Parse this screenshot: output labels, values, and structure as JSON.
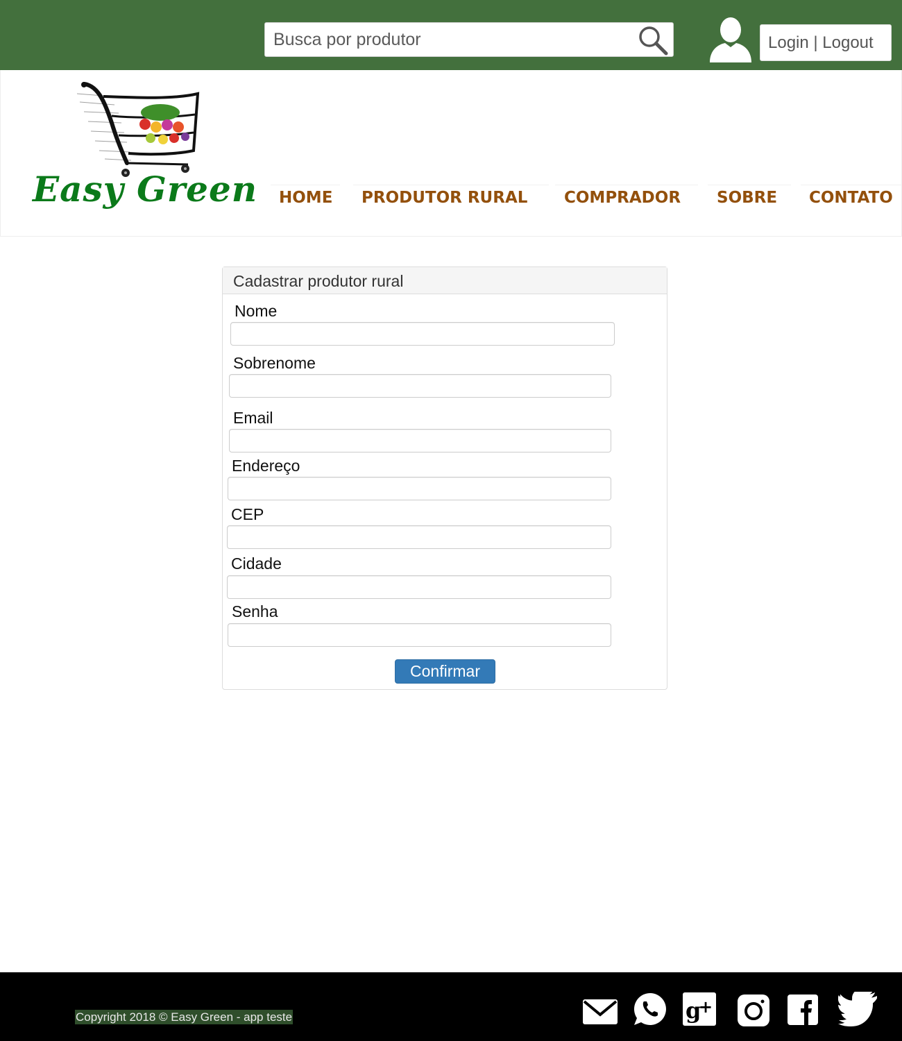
{
  "topbar": {
    "search_placeholder": "Busca por produtor",
    "login_label": "Login | Logout",
    "icons": [
      "search-icon",
      "user-icon"
    ]
  },
  "header": {
    "logo_text": "Easy Green",
    "nav": [
      "HOME",
      "PRODUTOR RURAL",
      "COMPRADOR",
      "SOBRE",
      "CONTATO"
    ]
  },
  "form": {
    "title": "Cadastrar produtor rural",
    "fields": [
      {
        "label": "Nome",
        "value": ""
      },
      {
        "label": "Sobrenome",
        "value": ""
      },
      {
        "label": "Email",
        "value": ""
      },
      {
        "label": "Endereço",
        "value": ""
      },
      {
        "label": "CEP",
        "value": ""
      },
      {
        "label": "Cidade",
        "value": ""
      },
      {
        "label": "Senha",
        "value": ""
      }
    ],
    "submit_label": "Confirmar"
  },
  "footer": {
    "copyright": "Copyright 2018 © Easy Green - app teste",
    "social_icons": [
      "mail-icon",
      "whatsapp-icon",
      "google-plus-icon",
      "instagram-icon",
      "facebook-icon",
      "twitter-icon"
    ]
  },
  "colors": {
    "topbar": "#43703d",
    "brand_green": "#0b7a1a",
    "nav_text": "#93500c",
    "button_primary": "#337ab7",
    "footer": "#000000"
  }
}
